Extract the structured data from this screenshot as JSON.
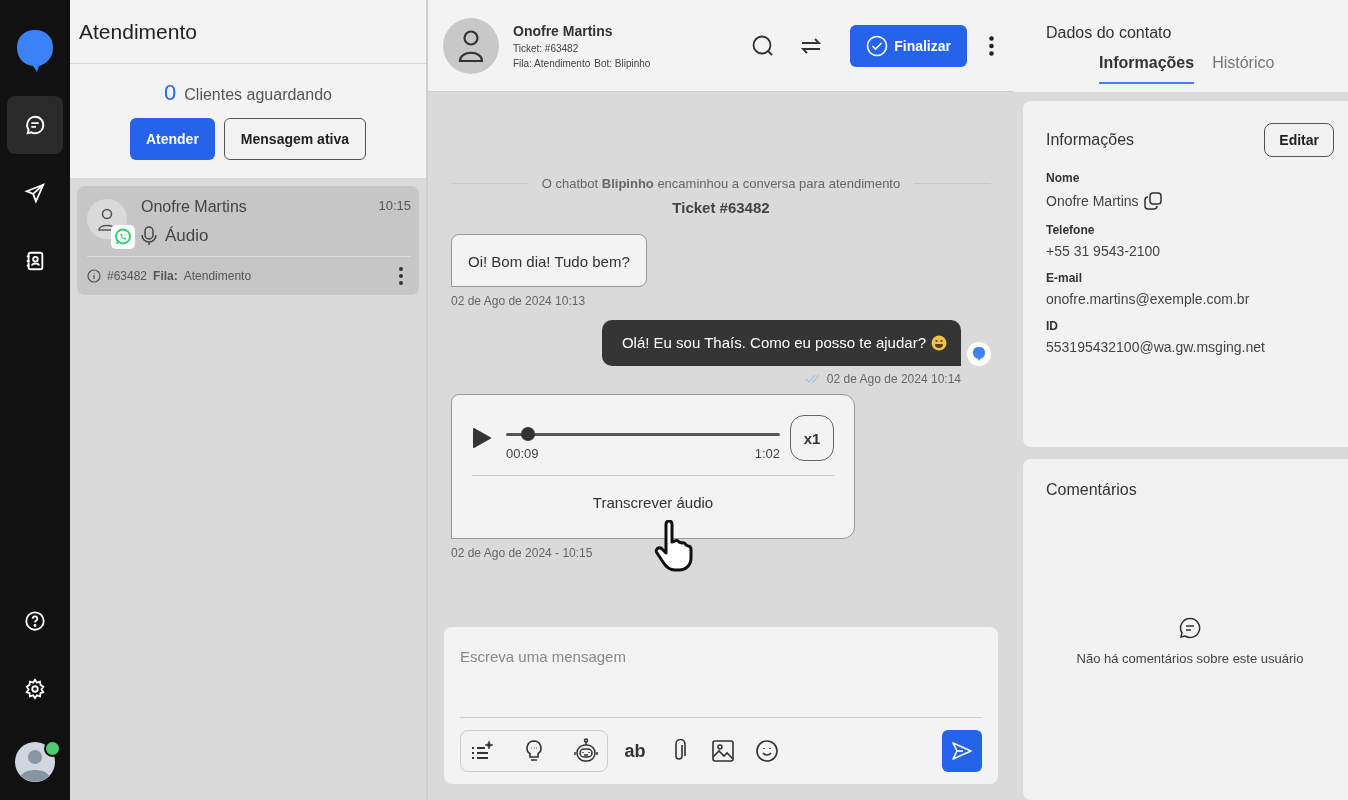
{
  "nav": {
    "items": [
      {
        "kind": "chat",
        "selected": true
      },
      {
        "kind": "send",
        "selected": false
      },
      {
        "kind": "contacts",
        "selected": false
      }
    ],
    "bottom": [
      {
        "kind": "help"
      },
      {
        "kind": "settings"
      }
    ],
    "user": {
      "online": true
    }
  },
  "queue": {
    "title": "Atendimento",
    "waiting_count": "0",
    "waiting_label": "Clientes aguardando",
    "primary_button": "Atender",
    "secondary_button": "Mensagem ativa"
  },
  "conversations": [
    {
      "name": "Onofre Martins",
      "time": "10:15",
      "preview": "Áudio",
      "ticket": "#63482",
      "queue_label": "Fila:",
      "queue": "Atendimento",
      "selected": true
    }
  ],
  "chat_header": {
    "name": "Onofre Martins",
    "ticket": "Ticket: #63482",
    "queue": "Fila: Atendimento",
    "bot": "Bot: Blipinho",
    "finish_button": "Finalizar"
  },
  "messages": [
    {
      "kind": "system",
      "text": "O chatbot **Blipinho** encaminhou a conversa para atendimento",
      "ticket": "Ticket #63482"
    },
    {
      "kind": "incoming",
      "text": "Oi! Bom dia! Tudo bem?",
      "time": "02 de Ago de 2024 10:13"
    },
    {
      "kind": "outgoing",
      "text": "Olá! Eu sou Thaís. Como eu posso te ajudar?",
      "time": "02 de Ago de 2024 10:14",
      "read": true
    },
    {
      "kind": "audio",
      "elapsed": "00:09",
      "duration": "1:02",
      "level": 0.08,
      "speed": "x1",
      "transcribe": "Transcrever áudio",
      "time": "02 de Ago de 2024 - 10:15"
    }
  ],
  "composer": {
    "placeholder": "Escreva uma mensagem",
    "format_label": "ab"
  },
  "contact": {
    "title": "Dados do contato",
    "tabs": [
      {
        "label": "Informações",
        "selected": true
      },
      {
        "label": "Histórico",
        "selected": false
      }
    ],
    "info_title": "Informações",
    "edit_button": "Editar",
    "fields": [
      {
        "label": "Nome",
        "value": "Onofre Martins",
        "copy": true
      },
      {
        "label": "Telefone",
        "value": "+55 31 9543-2100"
      },
      {
        "label": "E-mail",
        "value": "onofre.martins@exemple.com.br"
      },
      {
        "label": "ID",
        "value": "553195432100@wa.gw.msging.net"
      }
    ],
    "comments_title": "Comentários",
    "comments_empty": "Não há comentários sobre este usuário"
  }
}
